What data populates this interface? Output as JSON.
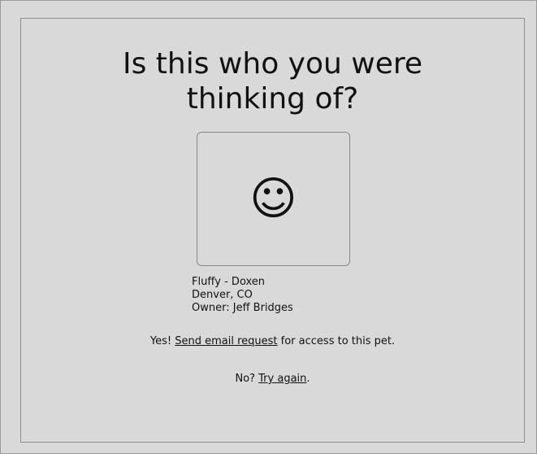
{
  "title": {
    "line1": "Is this who you were",
    "line2": "thinking of?"
  },
  "photo": {
    "glyph": "☺",
    "icon": "smiley-face-icon"
  },
  "pet": {
    "name_breed": "Fluffy - Doxen",
    "location": "Denver, CO",
    "owner": "Owner: Jeff Bridges"
  },
  "yes_prompt": {
    "prefix": "Yes! ",
    "link": "Send email request",
    "suffix": " for access to this pet."
  },
  "no_prompt": {
    "prefix": "No? ",
    "link": "Try again",
    "suffix": "."
  }
}
